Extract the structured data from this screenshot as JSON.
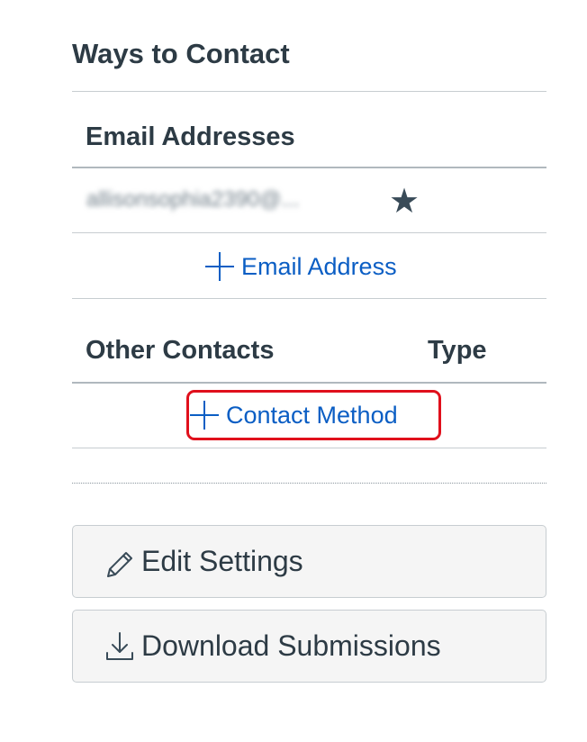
{
  "section": {
    "title": "Ways to Contact"
  },
  "email_table": {
    "header": "Email Addresses",
    "rows": [
      {
        "address": "allisonsophia2390@...",
        "default_icon": "star-icon"
      }
    ],
    "add_label": "Email Address",
    "add_icon": "plus-icon"
  },
  "other_table": {
    "headers": [
      "Other Contacts",
      "Type"
    ],
    "add_label": "Contact Method",
    "add_icon": "plus-icon"
  },
  "actions": {
    "edit_settings": {
      "label": "Edit Settings",
      "icon": "pencil-icon"
    },
    "download_submissions": {
      "label": "Download Submissions",
      "icon": "download-icon"
    }
  },
  "colors": {
    "link": "#0b5ec4",
    "highlight": "#e0101c",
    "text": "#2d3b45"
  }
}
